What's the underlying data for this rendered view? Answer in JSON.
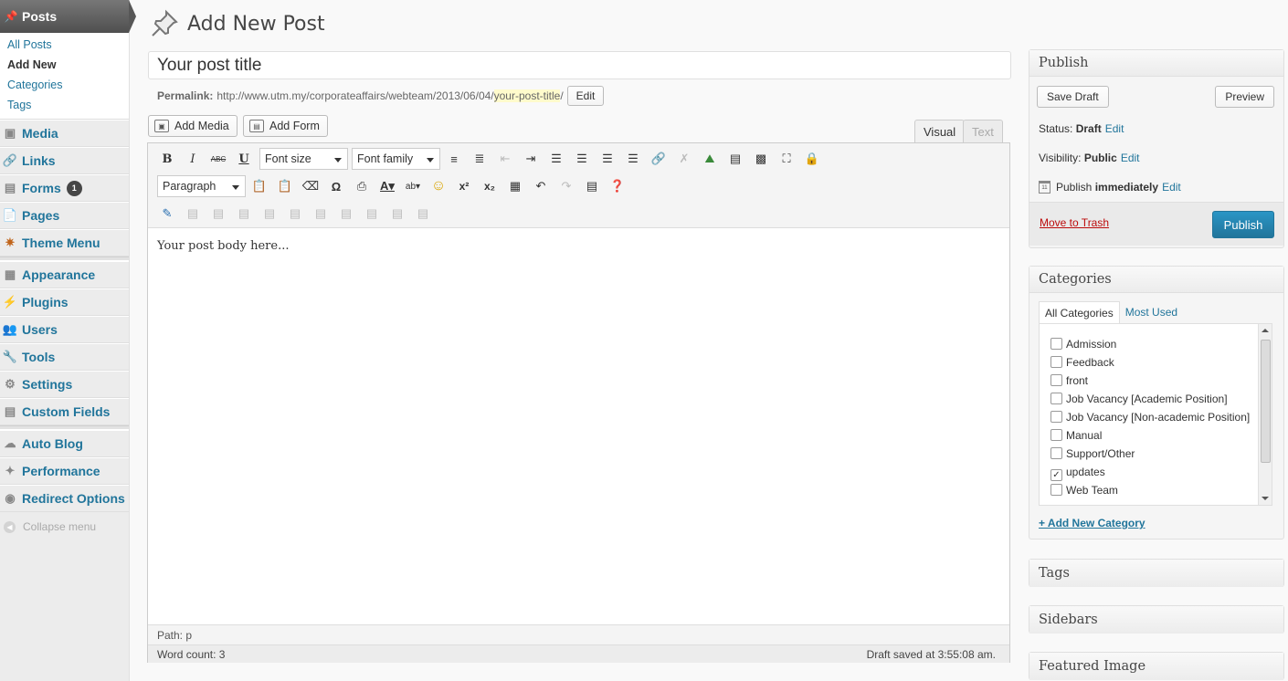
{
  "menu": {
    "posts_label": "Posts",
    "submenu": [
      "All Posts",
      "Add New",
      "Categories",
      "Tags"
    ],
    "items_a": [
      {
        "label": "Media",
        "icon": "media-icon"
      },
      {
        "label": "Links",
        "icon": "links-icon"
      },
      {
        "label": "Forms",
        "icon": "forms-icon",
        "badge": "1"
      },
      {
        "label": "Pages",
        "icon": "pages-icon"
      },
      {
        "label": "Theme Menu",
        "icon": "theme-menu-icon"
      }
    ],
    "items_b": [
      {
        "label": "Appearance",
        "icon": "appearance-icon"
      },
      {
        "label": "Plugins",
        "icon": "plugins-icon"
      },
      {
        "label": "Users",
        "icon": "users-icon"
      },
      {
        "label": "Tools",
        "icon": "tools-icon"
      },
      {
        "label": "Settings",
        "icon": "settings-icon"
      },
      {
        "label": "Custom Fields",
        "icon": "custom-fields-icon"
      }
    ],
    "items_c": [
      {
        "label": "Auto Blog",
        "icon": "auto-blog-icon"
      },
      {
        "label": "Performance",
        "icon": "performance-icon"
      },
      {
        "label": "Redirect Options",
        "icon": "redirect-icon"
      }
    ],
    "collapse_label": "Collapse menu"
  },
  "page": {
    "title": "Add New Post",
    "post_title": "Your post title",
    "permalink_label": "Permalink:",
    "permalink_base": "http://www.utm.my/corporateaffairs/webteam/2013/06/04/",
    "permalink_slug": "your-post-title",
    "permalink_trailing": "/",
    "permalink_edit": "Edit"
  },
  "editor": {
    "add_media": "Add Media",
    "add_form": "Add Form",
    "tab_visual": "Visual",
    "tab_text": "Text",
    "font_size": "Font size",
    "font_family": "Font family",
    "format": "Paragraph",
    "body": "Your post body here...",
    "path": "Path: p",
    "word_count": "Word count: 3",
    "draft_saved": "Draft saved at 3:55:08 am."
  },
  "publish": {
    "heading": "Publish",
    "save_draft": "Save Draft",
    "preview": "Preview",
    "status_label": "Status:",
    "status_value": "Draft",
    "visibility_label": "Visibility:",
    "visibility_value": "Public",
    "publish_label": "Publish",
    "publish_value": "immediately",
    "edit": "Edit",
    "trash": "Move to Trash",
    "publish_button": "Publish"
  },
  "categories": {
    "heading": "Categories",
    "tab_all": "All Categories",
    "tab_most_used": "Most Used",
    "items": [
      {
        "label": "Admission",
        "checked": false
      },
      {
        "label": "Feedback",
        "checked": false
      },
      {
        "label": "front",
        "checked": false
      },
      {
        "label": "Job Vacancy [Academic Position]",
        "checked": false
      },
      {
        "label": "Job Vacancy [Non-academic Position]",
        "checked": false
      },
      {
        "label": "Manual",
        "checked": false
      },
      {
        "label": "Support/Other",
        "checked": false
      },
      {
        "label": "updates",
        "checked": true
      },
      {
        "label": "Web Team",
        "checked": false
      }
    ],
    "add_new": "+ Add New Category"
  },
  "boxes": {
    "tags": "Tags",
    "sidebars": "Sidebars",
    "featured_image": "Featured Image"
  },
  "colors": {
    "link": "#21759b",
    "trash": "#bc0b0b",
    "primary_button": "#21759b"
  }
}
